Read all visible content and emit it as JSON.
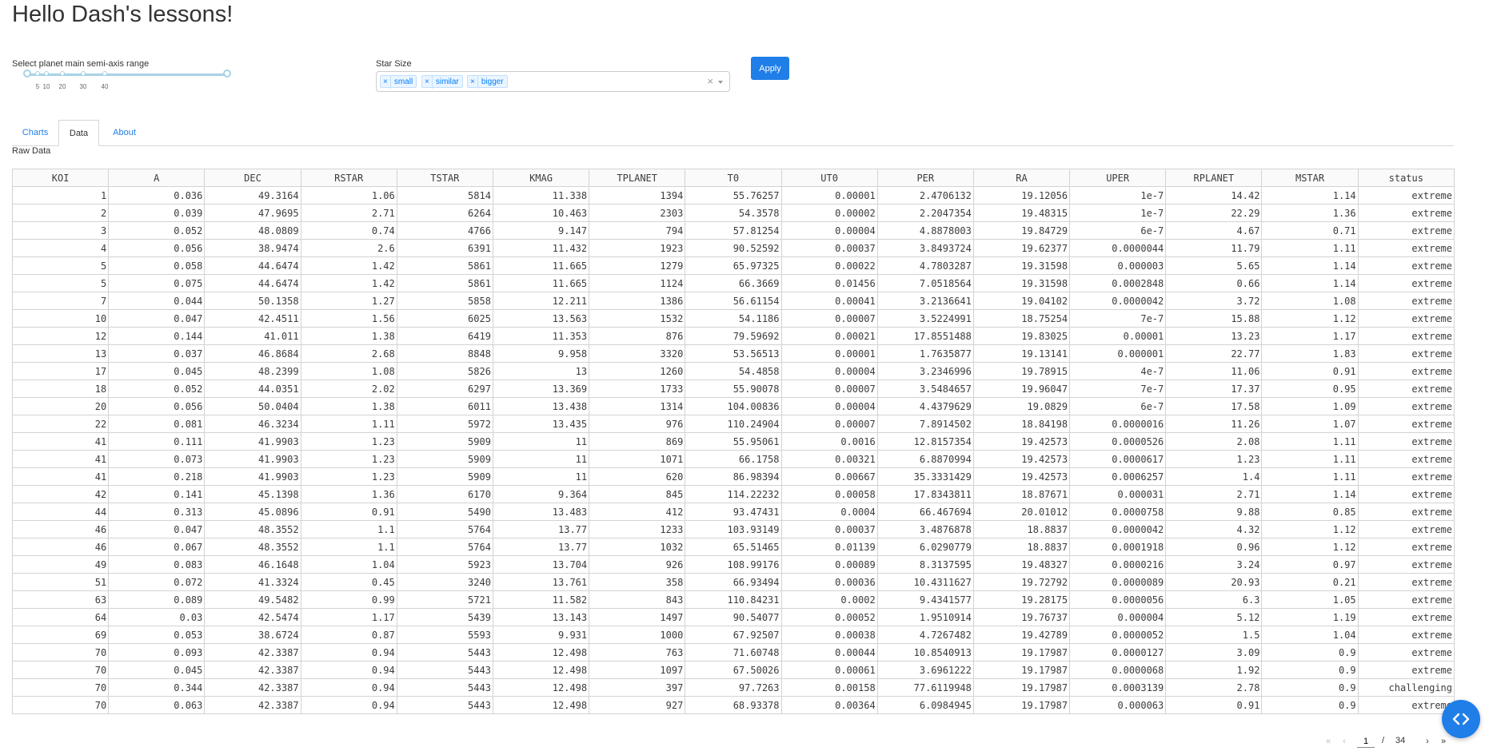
{
  "title": "Hello Dash's lessons!",
  "range_slider": {
    "label": "Select planet main semi-axis range",
    "marks": [
      "5",
      "10",
      "20",
      "30",
      "40"
    ]
  },
  "star_size": {
    "label": "Star Size",
    "selected": [
      "small",
      "similar",
      "bigger"
    ],
    "chip_remove": "×",
    "clear": "×"
  },
  "apply_label": "Apply",
  "tabs": [
    {
      "label": "Charts",
      "active": false
    },
    {
      "label": "Data",
      "active": true
    },
    {
      "label": "About",
      "active": false
    }
  ],
  "raw_data_label": "Raw Data",
  "table": {
    "columns": [
      "KOI",
      "A",
      "DEC",
      "RSTAR",
      "TSTAR",
      "KMAG",
      "TPLANET",
      "T0",
      "UT0",
      "PER",
      "RA",
      "UPER",
      "RPLANET",
      "MSTAR",
      "status"
    ],
    "rows": [
      [
        "1",
        "0.036",
        "49.3164",
        "1.06",
        "5814",
        "11.338",
        "1394",
        "55.76257",
        "0.00001",
        "2.4706132",
        "19.12056",
        "1e-7",
        "14.42",
        "1.14",
        "extreme"
      ],
      [
        "2",
        "0.039",
        "47.9695",
        "2.71",
        "6264",
        "10.463",
        "2303",
        "54.3578",
        "0.00002",
        "2.2047354",
        "19.48315",
        "1e-7",
        "22.29",
        "1.36",
        "extreme"
      ],
      [
        "3",
        "0.052",
        "48.0809",
        "0.74",
        "4766",
        "9.147",
        "794",
        "57.81254",
        "0.00004",
        "4.8878003",
        "19.84729",
        "6e-7",
        "4.67",
        "0.71",
        "extreme"
      ],
      [
        "4",
        "0.056",
        "38.9474",
        "2.6",
        "6391",
        "11.432",
        "1923",
        "90.52592",
        "0.00037",
        "3.8493724",
        "19.62377",
        "0.0000044",
        "11.79",
        "1.11",
        "extreme"
      ],
      [
        "5",
        "0.058",
        "44.6474",
        "1.42",
        "5861",
        "11.665",
        "1279",
        "65.97325",
        "0.00022",
        "4.7803287",
        "19.31598",
        "0.000003",
        "5.65",
        "1.14",
        "extreme"
      ],
      [
        "5",
        "0.075",
        "44.6474",
        "1.42",
        "5861",
        "11.665",
        "1124",
        "66.3669",
        "0.01456",
        "7.0518564",
        "19.31598",
        "0.0002848",
        "0.66",
        "1.14",
        "extreme"
      ],
      [
        "7",
        "0.044",
        "50.1358",
        "1.27",
        "5858",
        "12.211",
        "1386",
        "56.61154",
        "0.00041",
        "3.2136641",
        "19.04102",
        "0.0000042",
        "3.72",
        "1.08",
        "extreme"
      ],
      [
        "10",
        "0.047",
        "42.4511",
        "1.56",
        "6025",
        "13.563",
        "1532",
        "54.1186",
        "0.00007",
        "3.5224991",
        "18.75254",
        "7e-7",
        "15.88",
        "1.12",
        "extreme"
      ],
      [
        "12",
        "0.144",
        "41.011",
        "1.38",
        "6419",
        "11.353",
        "876",
        "79.59692",
        "0.00021",
        "17.8551488",
        "19.83025",
        "0.00001",
        "13.23",
        "1.17",
        "extreme"
      ],
      [
        "13",
        "0.037",
        "46.8684",
        "2.68",
        "8848",
        "9.958",
        "3320",
        "53.56513",
        "0.00001",
        "1.7635877",
        "19.13141",
        "0.000001",
        "22.77",
        "1.83",
        "extreme"
      ],
      [
        "17",
        "0.045",
        "48.2399",
        "1.08",
        "5826",
        "13",
        "1260",
        "54.4858",
        "0.00004",
        "3.2346996",
        "19.78915",
        "4e-7",
        "11.06",
        "0.91",
        "extreme"
      ],
      [
        "18",
        "0.052",
        "44.0351",
        "2.02",
        "6297",
        "13.369",
        "1733",
        "55.90078",
        "0.00007",
        "3.5484657",
        "19.96047",
        "7e-7",
        "17.37",
        "0.95",
        "extreme"
      ],
      [
        "20",
        "0.056",
        "50.0404",
        "1.38",
        "6011",
        "13.438",
        "1314",
        "104.00836",
        "0.00004",
        "4.4379629",
        "19.0829",
        "6e-7",
        "17.58",
        "1.09",
        "extreme"
      ],
      [
        "22",
        "0.081",
        "46.3234",
        "1.11",
        "5972",
        "13.435",
        "976",
        "110.24904",
        "0.00007",
        "7.8914502",
        "18.84198",
        "0.0000016",
        "11.26",
        "1.07",
        "extreme"
      ],
      [
        "41",
        "0.111",
        "41.9903",
        "1.23",
        "5909",
        "11",
        "869",
        "55.95061",
        "0.0016",
        "12.8157354",
        "19.42573",
        "0.0000526",
        "2.08",
        "1.11",
        "extreme"
      ],
      [
        "41",
        "0.073",
        "41.9903",
        "1.23",
        "5909",
        "11",
        "1071",
        "66.1758",
        "0.00321",
        "6.8870994",
        "19.42573",
        "0.0000617",
        "1.23",
        "1.11",
        "extreme"
      ],
      [
        "41",
        "0.218",
        "41.9903",
        "1.23",
        "5909",
        "11",
        "620",
        "86.98394",
        "0.00667",
        "35.3331429",
        "19.42573",
        "0.0006257",
        "1.4",
        "1.11",
        "extreme"
      ],
      [
        "42",
        "0.141",
        "45.1398",
        "1.36",
        "6170",
        "9.364",
        "845",
        "114.22232",
        "0.00058",
        "17.8343811",
        "18.87671",
        "0.000031",
        "2.71",
        "1.14",
        "extreme"
      ],
      [
        "44",
        "0.313",
        "45.0896",
        "0.91",
        "5490",
        "13.483",
        "412",
        "93.47431",
        "0.0004",
        "66.467694",
        "20.01012",
        "0.0000758",
        "9.88",
        "0.85",
        "extreme"
      ],
      [
        "46",
        "0.047",
        "48.3552",
        "1.1",
        "5764",
        "13.77",
        "1233",
        "103.93149",
        "0.00037",
        "3.4876878",
        "18.8837",
        "0.0000042",
        "4.32",
        "1.12",
        "extreme"
      ],
      [
        "46",
        "0.067",
        "48.3552",
        "1.1",
        "5764",
        "13.77",
        "1032",
        "65.51465",
        "0.01139",
        "6.0290779",
        "18.8837",
        "0.0001918",
        "0.96",
        "1.12",
        "extreme"
      ],
      [
        "49",
        "0.083",
        "46.1648",
        "1.04",
        "5923",
        "13.704",
        "926",
        "108.99176",
        "0.00089",
        "8.3137595",
        "19.48327",
        "0.0000216",
        "3.24",
        "0.97",
        "extreme"
      ],
      [
        "51",
        "0.072",
        "41.3324",
        "0.45",
        "3240",
        "13.761",
        "358",
        "66.93494",
        "0.00036",
        "10.4311627",
        "19.72792",
        "0.0000089",
        "20.93",
        "0.21",
        "extreme"
      ],
      [
        "63",
        "0.089",
        "49.5482",
        "0.99",
        "5721",
        "11.582",
        "843",
        "110.84231",
        "0.0002",
        "9.4341577",
        "19.28175",
        "0.0000056",
        "6.3",
        "1.05",
        "extreme"
      ],
      [
        "64",
        "0.03",
        "42.5474",
        "1.17",
        "5439",
        "13.143",
        "1497",
        "90.54077",
        "0.00052",
        "1.9510914",
        "19.76737",
        "0.000004",
        "5.12",
        "1.19",
        "extreme"
      ],
      [
        "69",
        "0.053",
        "38.6724",
        "0.87",
        "5593",
        "9.931",
        "1000",
        "67.92507",
        "0.00038",
        "4.7267482",
        "19.42789",
        "0.0000052",
        "1.5",
        "1.04",
        "extreme"
      ],
      [
        "70",
        "0.093",
        "42.3387",
        "0.94",
        "5443",
        "12.498",
        "763",
        "71.60748",
        "0.00044",
        "10.8540913",
        "19.17987",
        "0.0000127",
        "3.09",
        "0.9",
        "extreme"
      ],
      [
        "70",
        "0.045",
        "42.3387",
        "0.94",
        "5443",
        "12.498",
        "1097",
        "67.50026",
        "0.00061",
        "3.6961222",
        "19.17987",
        "0.0000068",
        "1.92",
        "0.9",
        "extreme"
      ],
      [
        "70",
        "0.344",
        "42.3387",
        "0.94",
        "5443",
        "12.498",
        "397",
        "97.7263",
        "0.00158",
        "77.6119948",
        "19.17987",
        "0.0003139",
        "2.78",
        "0.9",
        "challenging"
      ],
      [
        "70",
        "0.063",
        "42.3387",
        "0.94",
        "5443",
        "12.498",
        "927",
        "68.93378",
        "0.00364",
        "6.0984945",
        "19.17987",
        "0.000063",
        "0.91",
        "0.9",
        "extreme"
      ]
    ]
  },
  "pagination": {
    "first": "«",
    "prev": "‹",
    "current_page": "1",
    "separator": "/",
    "total_pages": "34",
    "next": "›",
    "last": "»"
  },
  "colors": {
    "accent": "#1f7ee8",
    "chip_text": "#007eff",
    "chip_bg": "#ebf5ff",
    "slider": "#a7d2e5"
  },
  "fab_icon": "code-brackets-icon"
}
